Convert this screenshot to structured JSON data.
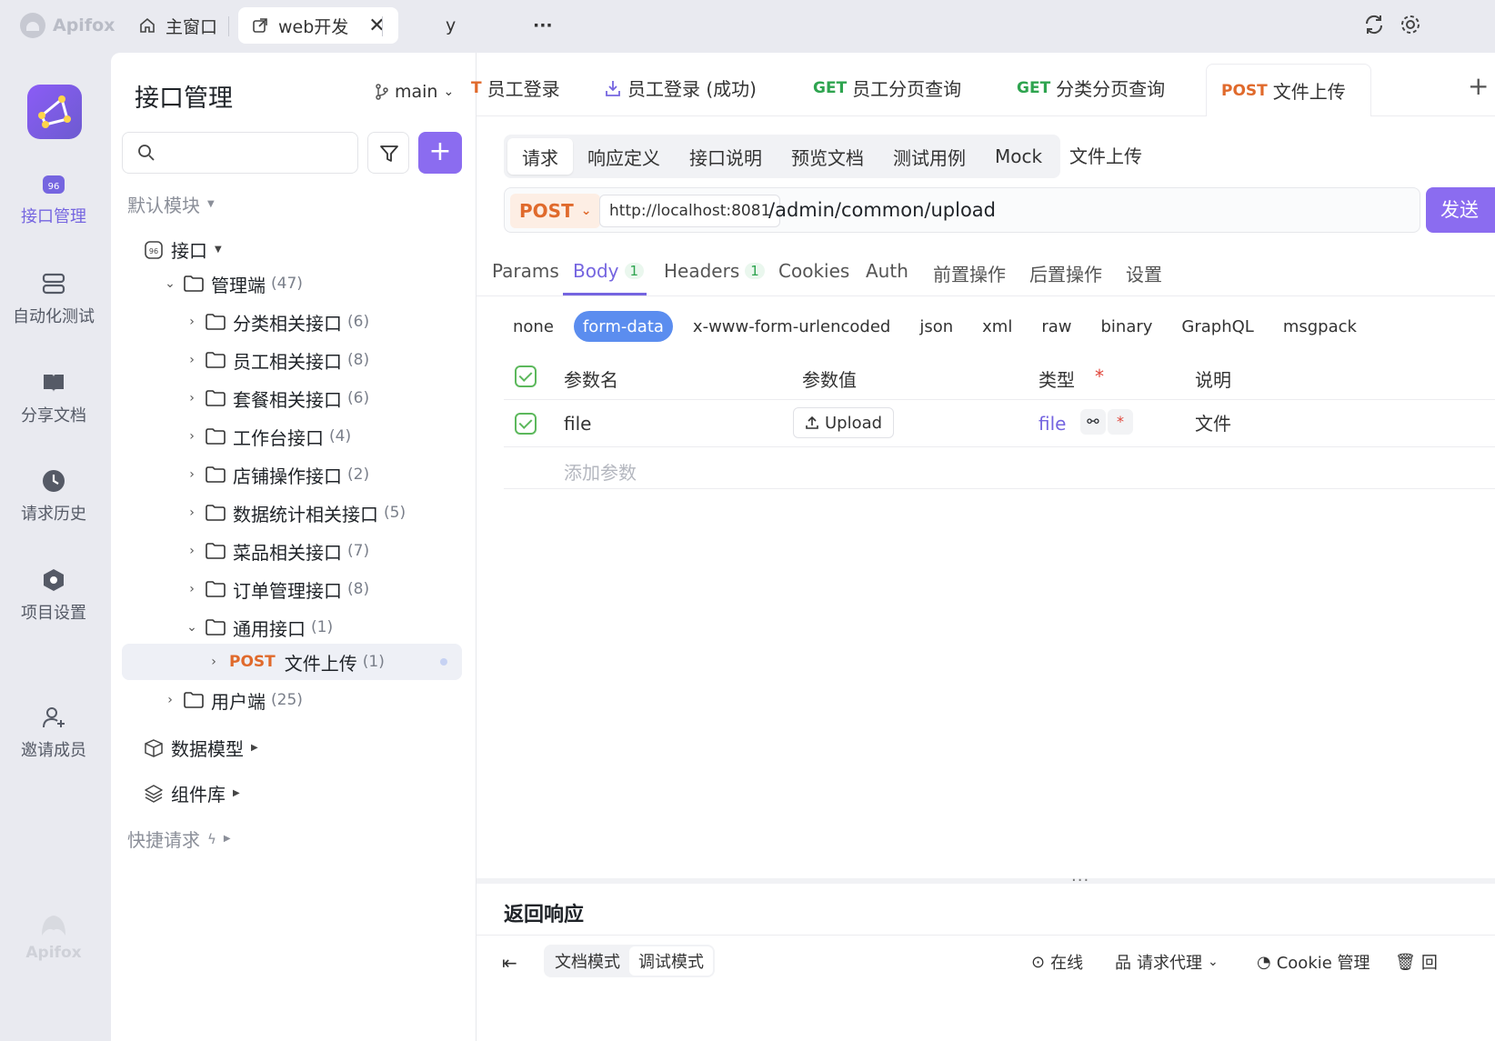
{
  "app": {
    "brand": "Apifox"
  },
  "window_tabs": [
    {
      "label": "主窗口",
      "icon": "home-icon"
    },
    {
      "label": "web开发",
      "icon": "external-link-icon",
      "close": "✕"
    },
    {
      "label": "y"
    },
    {
      "label": "···"
    }
  ],
  "rail": {
    "items": [
      {
        "label": "接口管理",
        "icon": "api-icon"
      },
      {
        "label": "自动化测试",
        "icon": "automation-icon"
      },
      {
        "label": "分享文档",
        "icon": "book-icon"
      },
      {
        "label": "请求历史",
        "icon": "clock-icon"
      },
      {
        "label": "项目设置",
        "icon": "settings-hex-icon"
      },
      {
        "label": "邀请成员",
        "icon": "add-user-icon"
      }
    ],
    "bottom_brand": "Apifox"
  },
  "sidebar": {
    "title": "接口管理",
    "branch": "main",
    "sections": {
      "default_module": "默认模块",
      "api_root": "接口",
      "data_model": "数据模型",
      "components": "组件库",
      "quick_request": "快捷请求"
    },
    "tree": [
      {
        "label": "管理端",
        "count": "(47)",
        "chev": "⌄",
        "level": 1
      },
      {
        "label": "分类相关接口",
        "count": "(6)",
        "chev": "›",
        "level": 2
      },
      {
        "label": "员工相关接口",
        "count": "(8)",
        "chev": "›",
        "level": 2
      },
      {
        "label": "套餐相关接口",
        "count": "(6)",
        "chev": "›",
        "level": 2
      },
      {
        "label": "工作台接口",
        "count": "(4)",
        "chev": "›",
        "level": 2
      },
      {
        "label": "店铺操作接口",
        "count": "(2)",
        "chev": "›",
        "level": 2
      },
      {
        "label": "数据统计相关接口",
        "count": "(5)",
        "chev": "›",
        "level": 2
      },
      {
        "label": "菜品相关接口",
        "count": "(7)",
        "chev": "›",
        "level": 2
      },
      {
        "label": "订单管理接口",
        "count": "(8)",
        "chev": "›",
        "level": 2
      },
      {
        "label": "通用接口",
        "count": "(1)",
        "chev": "⌄",
        "level": 2
      },
      {
        "method": "POST",
        "label": "文件上传",
        "count": "(1)",
        "chev": "›",
        "level": 3
      },
      {
        "label": "用户端",
        "count": "(25)",
        "chev": "›",
        "level": 1
      }
    ]
  },
  "request_tabs": [
    {
      "method": "T",
      "label": "员工登录"
    },
    {
      "method": "",
      "label": "员工登录 (成功)"
    },
    {
      "method": "GET",
      "label": "员工分页查询"
    },
    {
      "method": "GET",
      "label": "分类分页查询"
    },
    {
      "method": "POST",
      "label": "文件上传"
    }
  ],
  "segments": [
    "请求",
    "响应定义",
    "接口说明",
    "预览文档",
    "测试用例",
    "Mock"
  ],
  "segment_extra": "文件上传",
  "url": {
    "method": "POST",
    "host": "http://localhost:8081",
    "path": "/admin/common/upload",
    "send": "发送"
  },
  "sub_tabs": [
    {
      "label": "Params"
    },
    {
      "label": "Body",
      "badge": "1"
    },
    {
      "label": "Headers",
      "badge": "1"
    },
    {
      "label": "Cookies"
    },
    {
      "label": "Auth"
    },
    {
      "label": "前置操作"
    },
    {
      "label": "后置操作"
    },
    {
      "label": "设置"
    }
  ],
  "body_types": [
    "none",
    "form-data",
    "x-www-form-urlencoded",
    "json",
    "xml",
    "raw",
    "binary",
    "GraphQL",
    "msgpack"
  ],
  "params_table": {
    "headers": {
      "name": "参数名",
      "value": "参数值",
      "type": "类型",
      "desc": "说明",
      "required_mark": "*"
    },
    "rows": [
      {
        "name": "file",
        "value_button": "Upload",
        "type": "file",
        "required": "*",
        "desc": "文件"
      }
    ],
    "add_placeholder": "添加参数"
  },
  "response": {
    "title": "返回响应",
    "resize_handle": "···"
  },
  "bottom_bar": {
    "modes": [
      "文档模式",
      "调试模式"
    ],
    "online": "在线",
    "proxy": "请求代理",
    "cookie": "Cookie 管理",
    "recycle": "回"
  },
  "colors": {
    "accent": "#7565e0",
    "post": "#e06a2c",
    "get": "#2ea44f",
    "bodytype_active": "#5b8def"
  }
}
